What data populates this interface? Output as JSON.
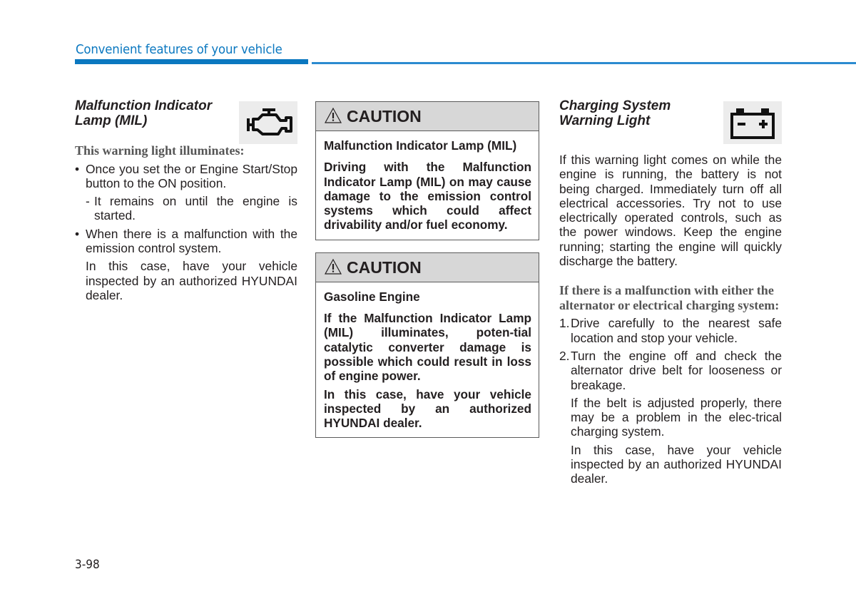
{
  "header": {
    "title": "Convenient features of your vehicle",
    "accent_color": "#0b78c0"
  },
  "left": {
    "title_line1": "Malfunction Indicator",
    "title_line2": "Lamp (MIL)",
    "icon": "check-engine-icon",
    "subheading": "This warning light illuminates:",
    "bullet1": "Once you set the or Engine Start/Stop button to the ON position.",
    "bullet1_sub_mark": "-",
    "bullet1_sub": "It remains on until the engine is started.",
    "bullet2": "When there is a malfunction with the emission control system.",
    "bullet2_note": "In this case, have your vehicle inspected by an authorized HYUNDAI dealer."
  },
  "middle": {
    "caution1": {
      "label": "CAUTION",
      "icon": "warning-triangle-icon",
      "heading": "Malfunction Indicator Lamp (MIL)",
      "body": "Driving with the Malfunction Indicator Lamp (MIL) on may cause damage to the emission control systems which could affect drivability and/or fuel economy."
    },
    "caution2": {
      "label": "CAUTION",
      "icon": "warning-triangle-icon",
      "heading": "Gasoline Engine",
      "body1": "If the Malfunction Indicator Lamp (MIL) illuminates, poten-tial catalytic converter damage is possible which could result in loss of engine power.",
      "body2": "In this case, have your vehicle inspected by an authorized HYUNDAI dealer."
    }
  },
  "right": {
    "title_line1": "Charging System",
    "title_line2": "Warning Light",
    "icon": "battery-icon",
    "intro": "If this warning light comes on while the engine is running, the battery is not being charged. Immediately turn off all electrical accessories. Try not to use electrically operated controls, such as the power windows. Keep the engine running; starting the engine will quickly discharge the battery.",
    "subheading": "If there is a malfunction with either the alternator or electrical charging system:",
    "step1_num": "1.",
    "step1": "Drive carefully to the nearest safe location and stop your vehicle.",
    "step2_num": "2.",
    "step2": "Turn the engine off and check the alternator drive belt for looseness or breakage.",
    "step2_note1": "If the belt is adjusted properly, there may be a problem in the elec-trical charging system.",
    "step2_note2": "In this case, have your vehicle inspected by an authorized HYUNDAI dealer."
  },
  "footer": {
    "page_number": "3-98"
  }
}
